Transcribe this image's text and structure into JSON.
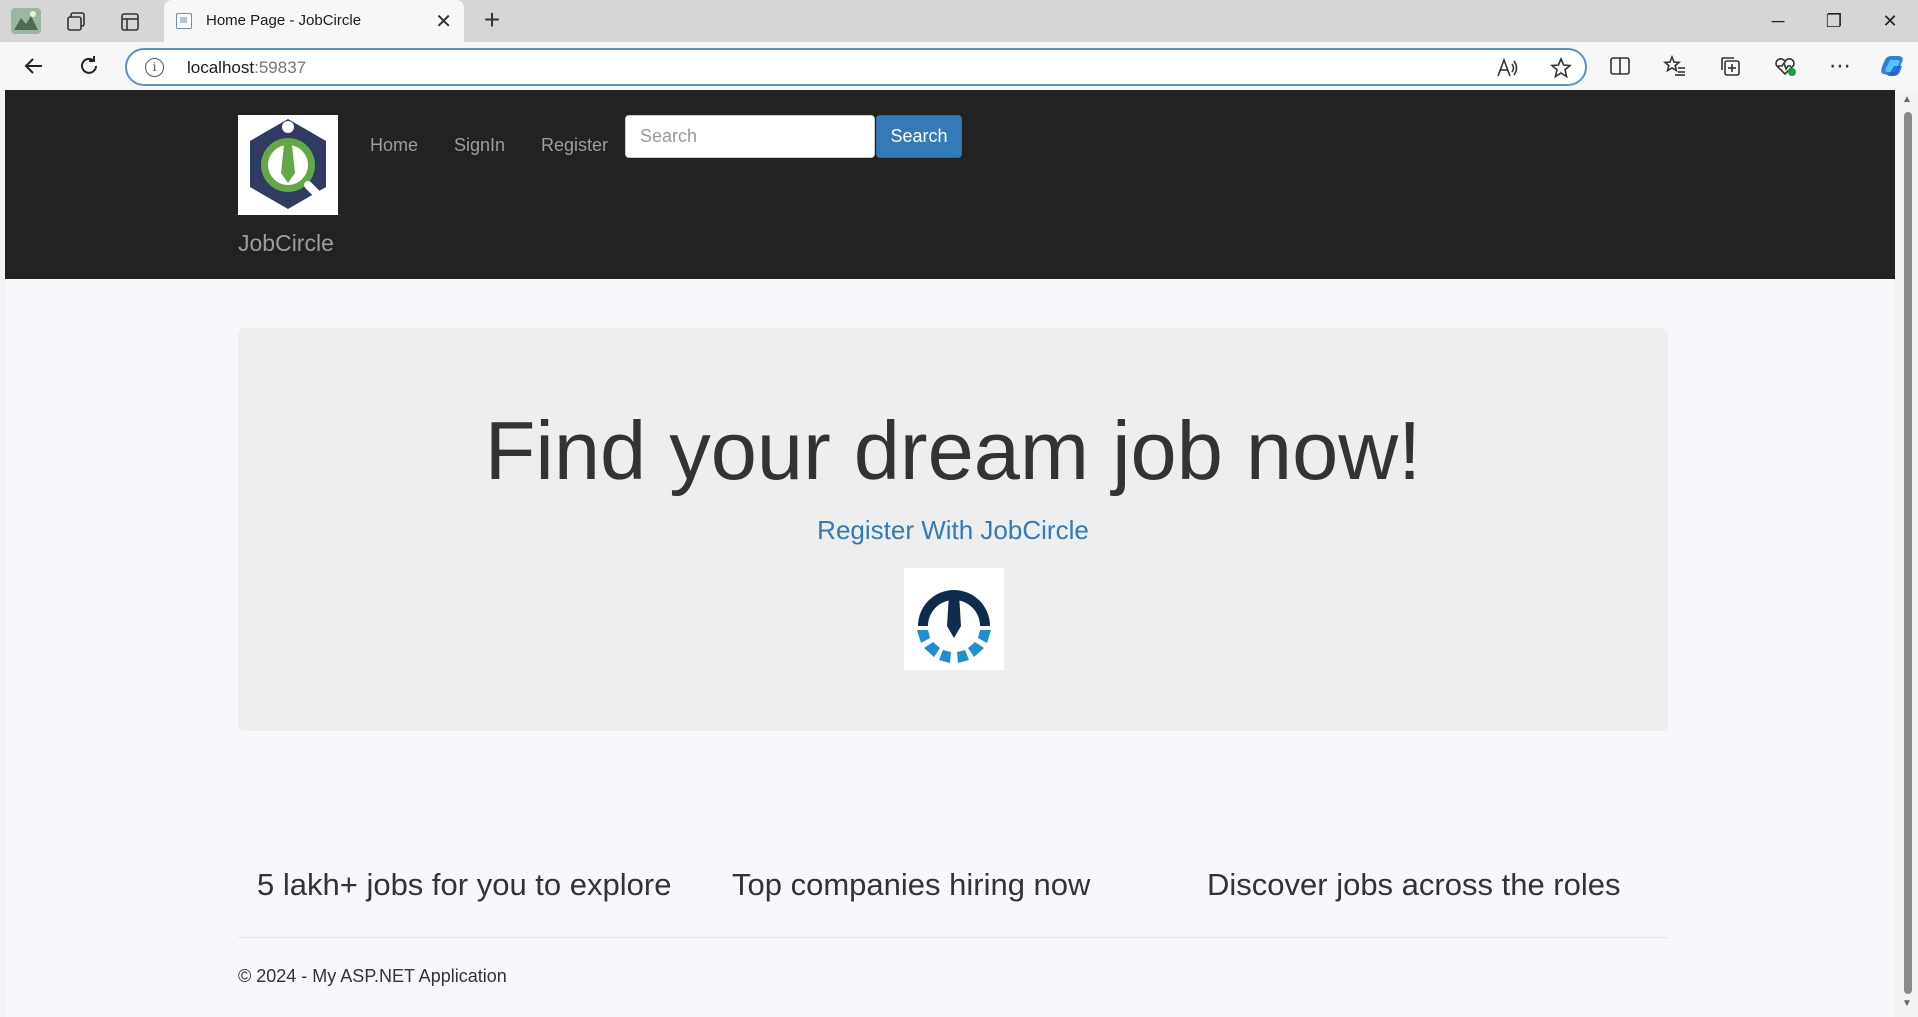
{
  "browser": {
    "tab_title": "Home Page - JobCircle",
    "tab_close": "✕",
    "new_tab": "+",
    "address_host": "localhost",
    "address_port": ":59837",
    "window_controls": {
      "minimize": "─",
      "restore": "❐",
      "close": "✕"
    }
  },
  "navbar": {
    "brand": "JobCircle",
    "links": [
      "Home",
      "SignIn",
      "Register"
    ],
    "search_placeholder": "Search",
    "search_button": "Search"
  },
  "hero": {
    "title": "Find your dream job now!",
    "register_link": "Register With JobCircle"
  },
  "features": [
    "5 lakh+ jobs for you to explore",
    "Top companies hiring now",
    "Discover jobs across the roles"
  ],
  "footer": {
    "copyright": "© 2024 - My ASP.NET Application"
  },
  "colors": {
    "navbar_bg": "#222222",
    "primary": "#337ab7",
    "logo_navy": "#2f3b63",
    "logo_green": "#63a844",
    "hero_logo_navy": "#0e2d4e",
    "hero_logo_blue": "#1e90cf"
  }
}
